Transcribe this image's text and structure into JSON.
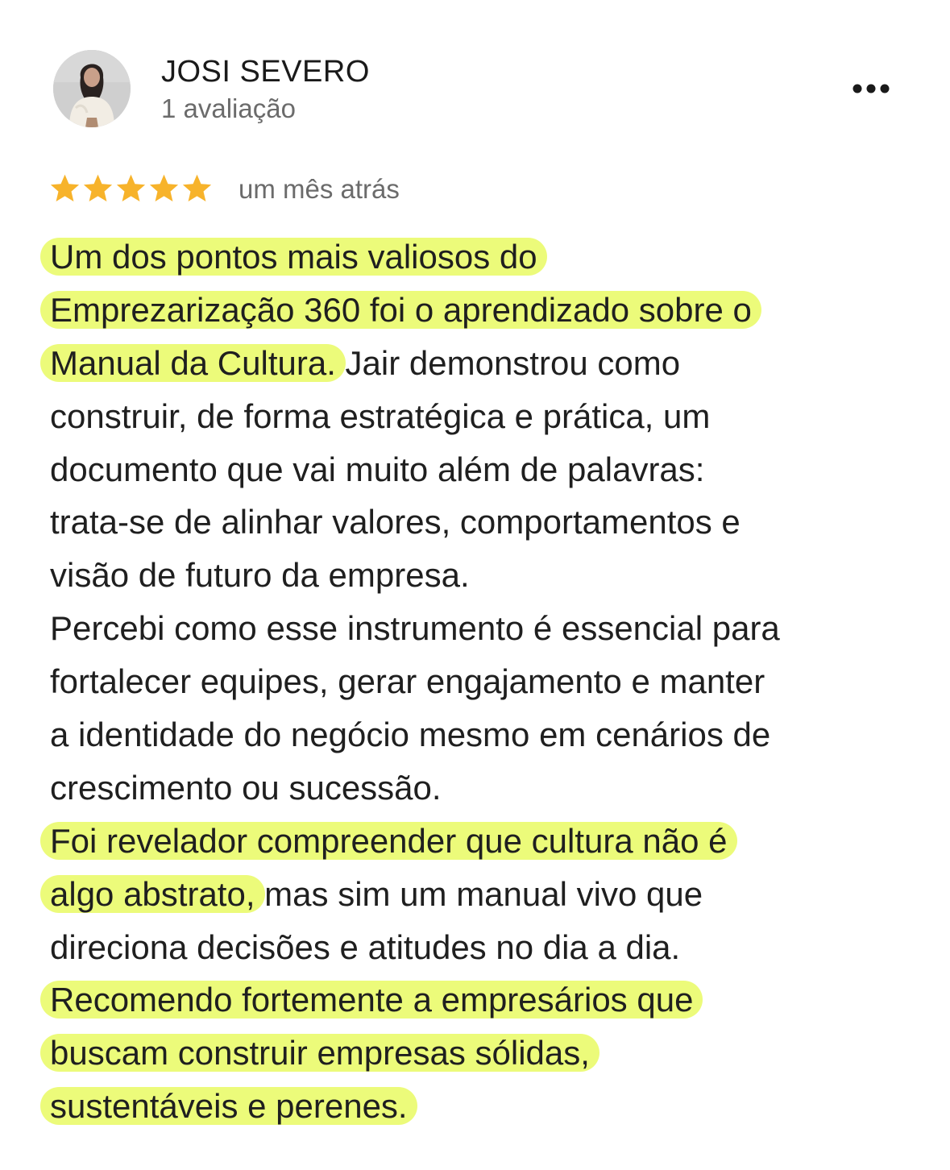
{
  "reviewer": {
    "name": "JOSI SEVERO",
    "review_count": "1 avaliação",
    "avatar_icon": "avatar-photo"
  },
  "menu": {
    "icon": "more-horizontal-icon"
  },
  "rating": {
    "stars": 5,
    "max_stars": 5,
    "star_color": "#F7B32B",
    "date": "um mês atrás"
  },
  "highlight_color": "#ECFB7A",
  "review": {
    "lines": [
      {
        "hl": "Um dos pontos mais valiosos do",
        "rest": ""
      },
      {
        "hl": "Emprezarização 360 foi o aprendizado sobre o",
        "rest": ""
      },
      {
        "hl": "Manual da Cultura.",
        "rest": " Jair demonstrou como"
      },
      {
        "hl": "",
        "rest": "construir, de forma estratégica e prática, um"
      },
      {
        "hl": "",
        "rest": "documento que vai muito além de palavras:"
      },
      {
        "hl": "",
        "rest": "trata-se de alinhar valores, comportamentos e"
      },
      {
        "hl": "",
        "rest": "visão de futuro da empresa."
      },
      {
        "hl": "",
        "rest": "Percebi como esse instrumento é essencial para"
      },
      {
        "hl": "",
        "rest": "fortalecer equipes, gerar engajamento e manter"
      },
      {
        "hl": "",
        "rest": "a identidade do negócio mesmo em cenários de"
      },
      {
        "hl": "",
        "rest": "crescimento ou sucessão."
      },
      {
        "hl": "Foi revelador compreender que cultura não é",
        "rest": ""
      },
      {
        "hl": "algo abstrato,",
        "rest": " mas sim um manual vivo que"
      },
      {
        "hl": "",
        "rest": "direciona decisões e atitudes no dia a dia."
      },
      {
        "hl": "Recomendo fortemente a empresários que",
        "rest": ""
      },
      {
        "hl": "buscam construir empresas sólidas,",
        "rest": ""
      },
      {
        "hl": "sustentáveis e perenes.",
        "rest": ""
      }
    ]
  }
}
